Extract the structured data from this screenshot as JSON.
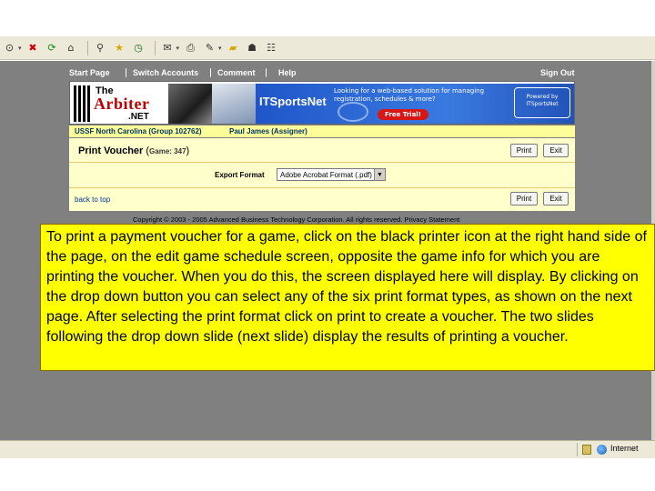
{
  "toolbar": {
    "icons": [
      "back-icon",
      "stop-icon",
      "refresh-icon",
      "home-icon",
      "search-icon",
      "favorites-icon",
      "history-icon",
      "mail-icon",
      "print-icon",
      "edit-icon",
      "discuss-icon",
      "folder-icon",
      "messenger-icon",
      "research-icon"
    ]
  },
  "nav": {
    "start_page": "Start Page",
    "switch_accounts": "Switch Accounts",
    "comment": "Comment",
    "help": "Help",
    "sign_out": "Sign Out"
  },
  "banner": {
    "logo_the": "The",
    "logo_arbiter": "Arbiter",
    "logo_net": ".NET",
    "itsports_name": "ITSportsNet",
    "tagline": "Looking for a web-based solution for managing registration, schedules & more?",
    "free_trial": "Free Trial!",
    "powered_by": "Powered by ITSportsNet"
  },
  "group": {
    "name": "USSF North Carolina (Group 102762)",
    "user": "Paul James (Assigner)"
  },
  "voucher": {
    "title": "Print Voucher",
    "game_label": "Game: 347",
    "print_label": "Print",
    "exit_label": "Exit",
    "export_label": "Export Format",
    "export_value": "Adobe Acrobat Format (.pdf)",
    "back_to_top": "back to top"
  },
  "copyright": "Copyright © 2003 - 2005 Advanced Business Technology Corporation. All rights reserved. Privacy Statement",
  "callout": "To print a payment voucher for a game, click on the black printer icon at the right hand side of the page, on the edit game schedule screen, opposite the game info for which you are printing the voucher.  When you do this, the screen displayed here will display.  By clicking on the drop down button you can select any of the six print format types, as shown on the next page.  After selecting the print format click on print to create a voucher.  The two slides following the drop down slide (next slide) display the results of printing a voucher.",
  "status": {
    "zone": "Internet"
  }
}
